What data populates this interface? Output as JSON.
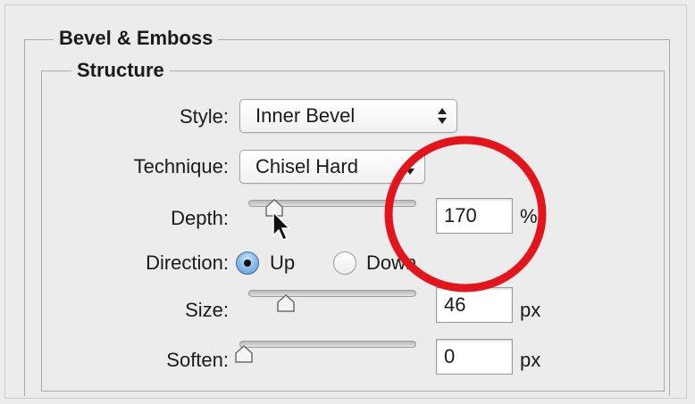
{
  "panel": {
    "group_title": "Bevel & Emboss",
    "section_title": "Structure"
  },
  "fields": {
    "style": {
      "label": "Style:",
      "value": "Inner Bevel"
    },
    "technique": {
      "label": "Technique:",
      "value": "Chisel Hard"
    },
    "depth": {
      "label": "Depth:",
      "value": "170",
      "unit": "%",
      "slider_fraction": 0.17
    },
    "direction": {
      "label": "Direction:",
      "options": [
        "Up",
        "Down"
      ],
      "selected": "Up"
    },
    "size": {
      "label": "Size:",
      "value": "46",
      "unit": "px",
      "slider_fraction": 0.23
    },
    "soften": {
      "label": "Soften:",
      "value": "0",
      "unit": "px",
      "slider_fraction": 0.0
    }
  },
  "icons": {
    "popup_arrows": "up-down-arrows-icon",
    "cursor": "mouse-pointer-icon",
    "highlight": "red-annotation-circle"
  },
  "colors": {
    "annotation": "#e3141b",
    "radio_selected": "#7fb3e4",
    "background": "#ececec"
  }
}
